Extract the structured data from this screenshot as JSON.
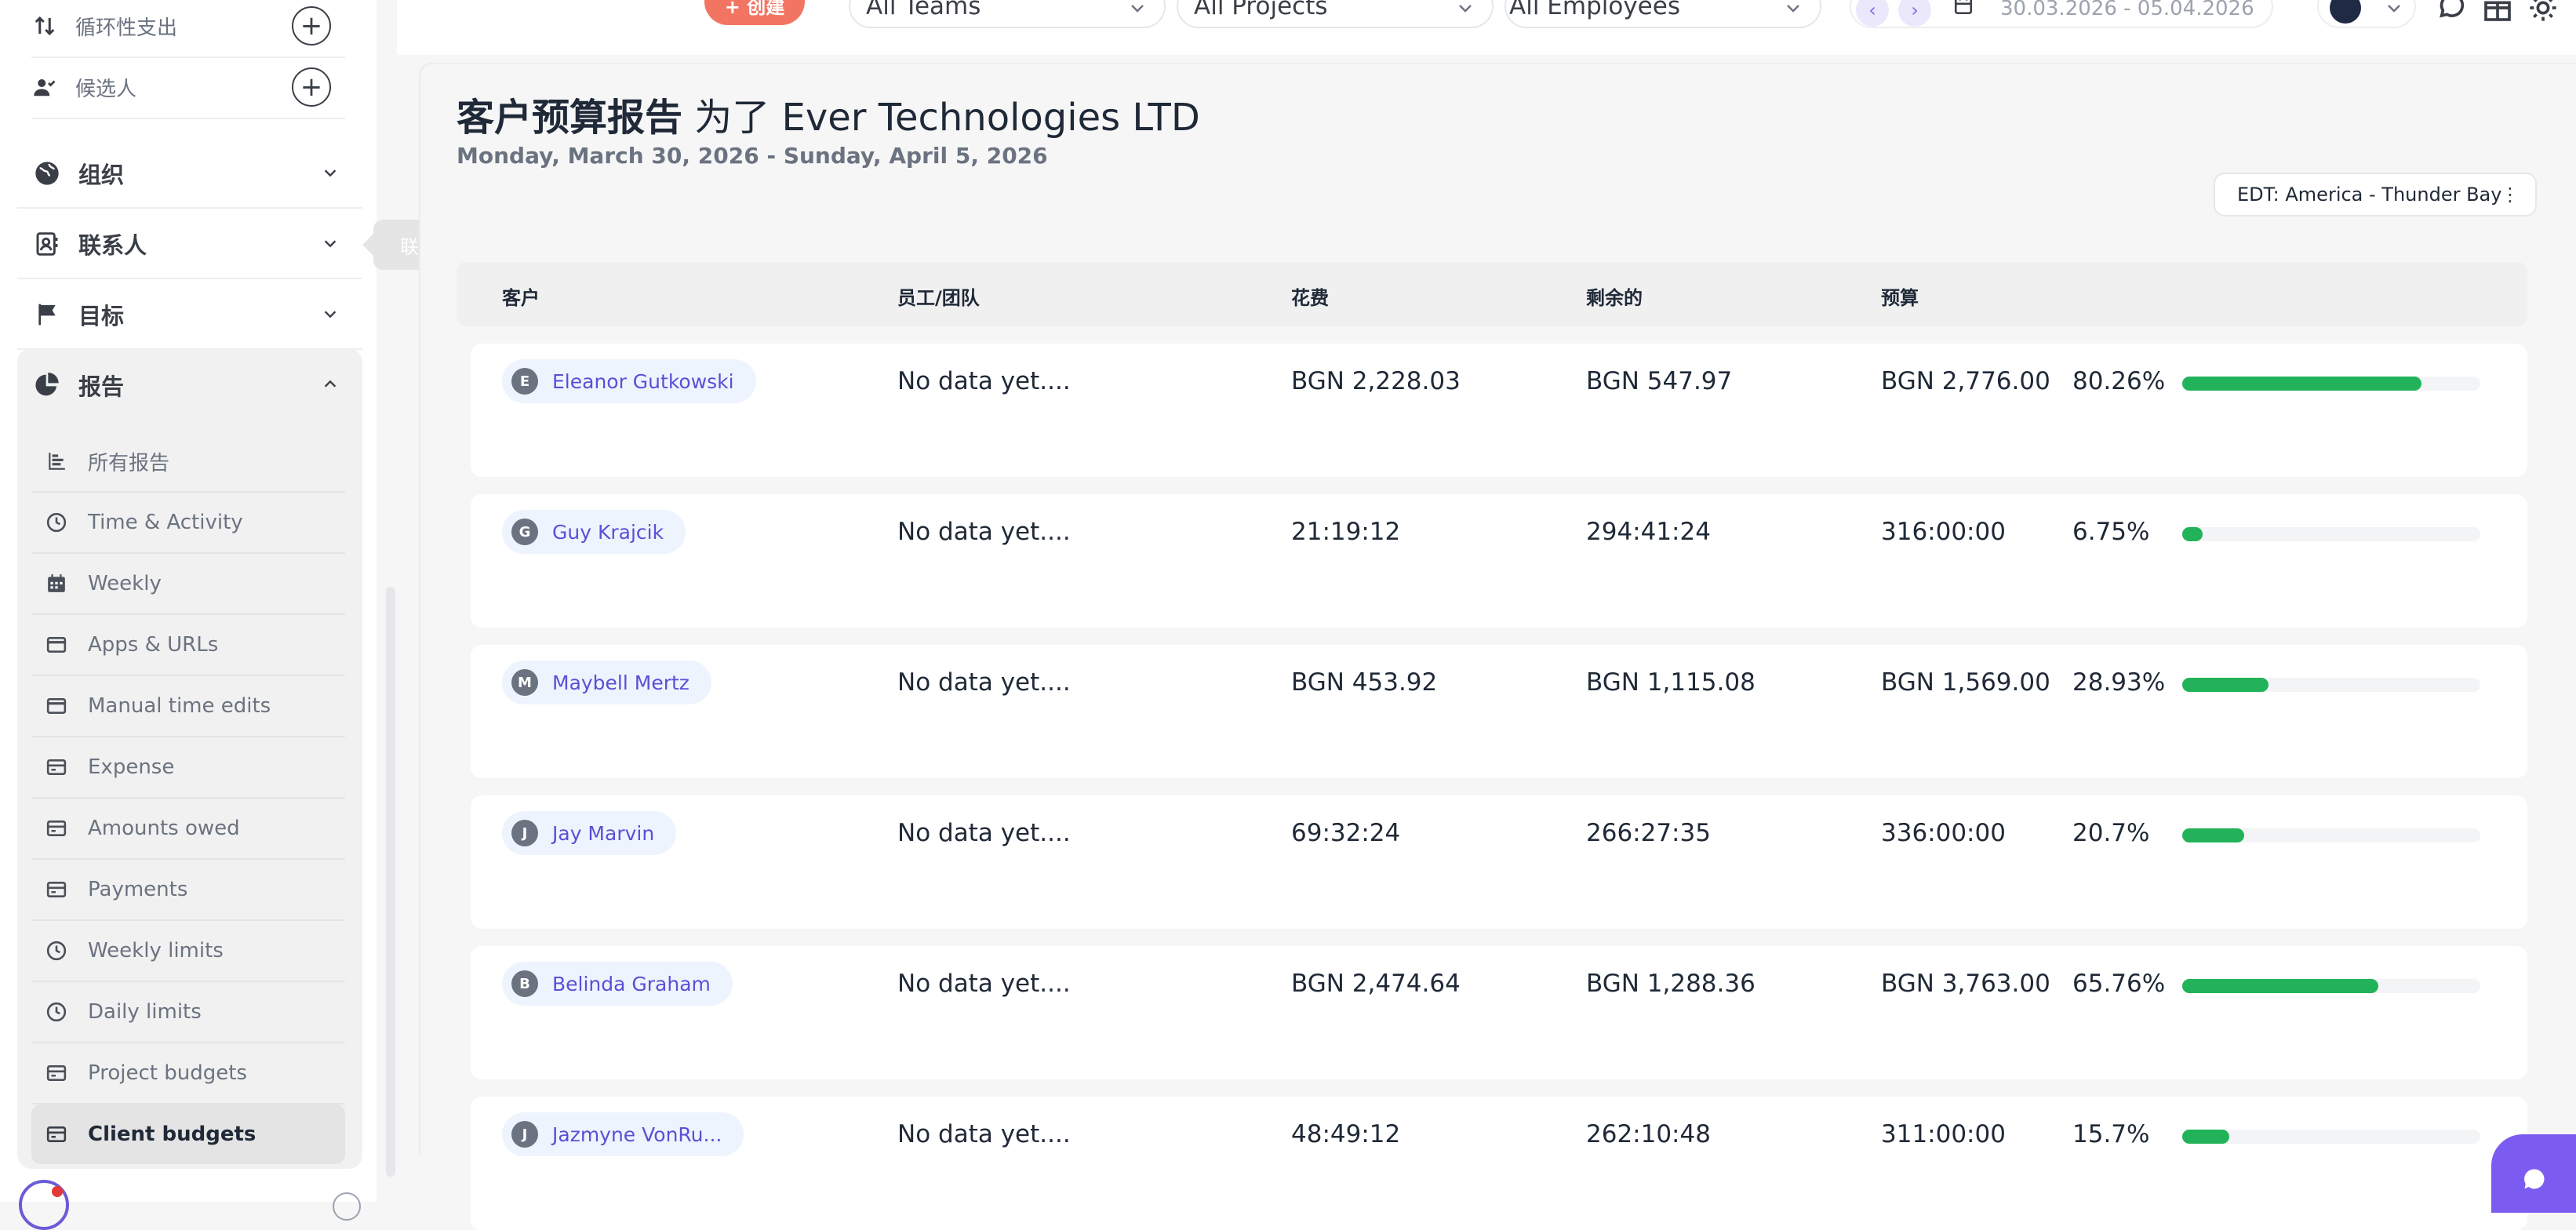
{
  "sidebar": {
    "sub_items": [
      {
        "label": "循环性支出",
        "icon": "sort-arrows-icon"
      },
      {
        "label": "候选人",
        "icon": "user-check-icon"
      }
    ],
    "sections": [
      {
        "label": "组织",
        "icon": "globe-icon"
      },
      {
        "label": "联系人",
        "icon": "contact-card-icon"
      },
      {
        "label": "目标",
        "icon": "flag-icon"
      },
      {
        "label": "报告",
        "icon": "pie-chart-icon"
      }
    ],
    "reports": [
      {
        "label": "所有报告",
        "icon": "bar-chart-icon"
      },
      {
        "label": "Time & Activity",
        "icon": "clock-icon"
      },
      {
        "label": "Weekly",
        "icon": "calendar-icon"
      },
      {
        "label": "Apps & URLs",
        "icon": "card-icon"
      },
      {
        "label": "Manual time edits",
        "icon": "card-icon"
      },
      {
        "label": "Expense",
        "icon": "card-icon"
      },
      {
        "label": "Amounts owed",
        "icon": "card-icon"
      },
      {
        "label": "Payments",
        "icon": "card-icon"
      },
      {
        "label": "Weekly limits",
        "icon": "clock-icon"
      },
      {
        "label": "Daily limits",
        "icon": "clock-icon"
      },
      {
        "label": "Project budgets",
        "icon": "card-icon"
      },
      {
        "label": "Client budgets",
        "icon": "card-icon"
      }
    ],
    "tooltip": "联系人"
  },
  "topbar": {
    "create_label": "+ 创建",
    "teams": "All Teams",
    "projects": "All Projects",
    "employees": "All Employees",
    "date_range": "30.03.2026 - 05.04.2026"
  },
  "main": {
    "title_bold": "客户预算报告",
    "title_rest": " 为了 Ever Technologies LTD",
    "subtitle": "Monday, March 30, 2026 - Sunday, April 5, 2026",
    "timezone": "EDT: America - Thunder Bay"
  },
  "table": {
    "headers": [
      "客户",
      "员工/团队",
      "花费",
      "剩余的",
      "预算"
    ],
    "rows": [
      {
        "initial": "E",
        "client": "Eleanor Gutkowski",
        "employee": "No data yet....",
        "spent": "BGN 2,228.03",
        "remaining": "BGN 547.97",
        "budget": "BGN 2,776.00",
        "percent": "80.26%",
        "progress": 80.26
      },
      {
        "initial": "G",
        "client": "Guy Krajcik",
        "employee": "No data yet....",
        "spent": "21:19:12",
        "remaining": "294:41:24",
        "budget": "316:00:00",
        "percent": "6.75%",
        "progress": 6.75
      },
      {
        "initial": "M",
        "client": "Maybell Mertz",
        "employee": "No data yet....",
        "spent": "BGN 453.92",
        "remaining": "BGN 1,115.08",
        "budget": "BGN 1,569.00",
        "percent": "28.93%",
        "progress": 28.93
      },
      {
        "initial": "J",
        "client": "Jay Marvin",
        "employee": "No data yet....",
        "spent": "69:32:24",
        "remaining": "266:27:35",
        "budget": "336:00:00",
        "percent": "20.7%",
        "progress": 20.7
      },
      {
        "initial": "B",
        "client": "Belinda Graham",
        "employee": "No data yet....",
        "spent": "BGN 2,474.64",
        "remaining": "BGN 1,288.36",
        "budget": "BGN 3,763.00",
        "percent": "65.76%",
        "progress": 65.76
      },
      {
        "initial": "J",
        "client": "Jazmyne VonRu...",
        "employee": "No data yet....",
        "spent": "48:49:12",
        "remaining": "262:10:48",
        "budget": "311:00:00",
        "percent": "15.7%",
        "progress": 15.7
      }
    ]
  },
  "colors": {
    "accent": "#7c5cf0",
    "progress": "#22b35a",
    "create": "#f27564"
  }
}
